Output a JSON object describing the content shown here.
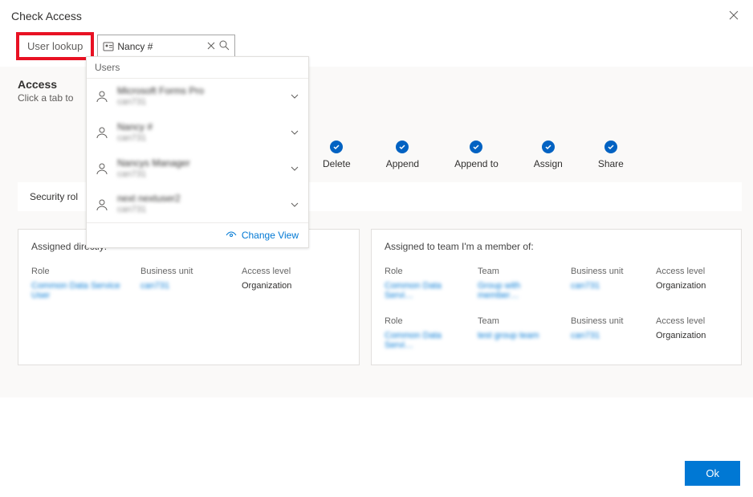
{
  "header": {
    "title": "Check Access",
    "close_aria": "Close"
  },
  "toolbar": {
    "user_lookup_label": "User lookup",
    "search_value": "Nancy #",
    "clear_aria": "Clear",
    "search_aria": "Search"
  },
  "dropdown": {
    "header": "Users",
    "items": [
      {
        "name": "Microsoft Forms Pro",
        "sub": "can731"
      },
      {
        "name": "Nancy #",
        "sub": "can731"
      },
      {
        "name": "Nancys Manager",
        "sub": "can731"
      },
      {
        "name": "next nextuser2",
        "sub": "can731"
      }
    ],
    "change_view": "Change View"
  },
  "access": {
    "title": "Access",
    "subtitle": "Click a tab to"
  },
  "permissions": [
    "Delete",
    "Append",
    "Append to",
    "Assign",
    "Share"
  ],
  "tab_strip": {
    "label": "Security rol"
  },
  "panels": {
    "left": {
      "title": "Assigned directly:",
      "headers": [
        "Role",
        "Business unit",
        "Access level"
      ],
      "rows": [
        {
          "role": "Common Data Service User",
          "bu": "can731",
          "level": "Organization"
        }
      ]
    },
    "right": {
      "title": "Assigned to team I'm a member of:",
      "headers": [
        "Role",
        "Team",
        "Business unit",
        "Access level"
      ],
      "rows": [
        {
          "role": "Common Data Servi…",
          "team": "Group with member…",
          "bu": "can731",
          "level": "Organization"
        },
        {
          "role": "Common Data Servi…",
          "team": "test group team",
          "bu": "can731",
          "level": "Organization"
        }
      ]
    }
  },
  "footer": {
    "ok": "Ok"
  }
}
